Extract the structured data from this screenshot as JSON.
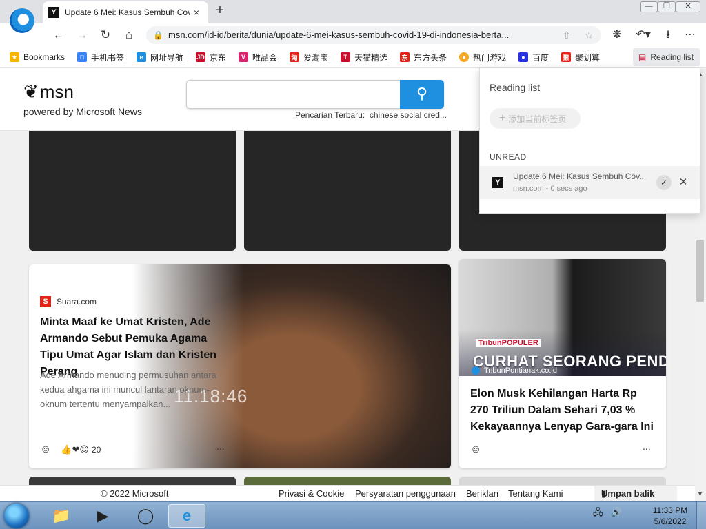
{
  "browser": {
    "tab_title": "Update 6 Mei: Kasus Sembuh Cov",
    "tab_close": "×",
    "new_tab": "+",
    "url": "msn.com/id-id/berita/dunia/update-6-mei-kasus-sembuh-covid-19-di-indonesia-berta...",
    "window_buttons": {
      "minimize": "—",
      "restore": "❐",
      "close": "✕"
    }
  },
  "bookmarks": {
    "items": [
      {
        "label": "Bookmarks",
        "color": "#f5b400"
      },
      {
        "label": "手机书签",
        "color": "#3b82f6"
      },
      {
        "label": "网址导航",
        "color": "#1f8fe0"
      },
      {
        "label": "京东",
        "color": "#c8102e"
      },
      {
        "label": "唯品会",
        "color": "#d6246e"
      },
      {
        "label": "爱淘宝",
        "color": "#e2231a"
      },
      {
        "label": "天猫精选",
        "color": "#c8102e"
      },
      {
        "label": "东方头条",
        "color": "#e2231a"
      },
      {
        "label": "热门游戏",
        "color": "#f5a623"
      },
      {
        "label": "百度",
        "color": "#2932e1"
      },
      {
        "label": "聚划算",
        "color": "#e2231a"
      }
    ],
    "reading_list_label": "Reading list"
  },
  "msn": {
    "logo_text": "msn",
    "powered_by": "powered by Microsoft News",
    "recent_label": "Pencarian Terbaru:",
    "recent_term": "chinese social cred..."
  },
  "cards": {
    "card1": {
      "source": "Suara.com",
      "source_color": "#e2231a",
      "headline": "Minta Maaf ke Umat Kristen, Ade Armando Sebut Pemuka Agama Tipu Umat Agar Islam dan Kristen Perang",
      "summary": "Ade Armando menuding permusuhan antara kedua ahgama ini muncul lantaran oknum-oknum tertentu menyampaikan...",
      "video_time": "11.18:46",
      "reactions_count": "20",
      "more": "..."
    },
    "card2": {
      "source": "TribunPontianak.co.id",
      "popular_tag": "TribunPOPULER",
      "banner": "CURHAT SEORANG PENDIRI TWITTER",
      "headline": "Elon Musk Kehilangan Harta Rp 270 Triliun Dalam Sehari 7,03 % Kekayaannya Lenyap Gara-gara Ini",
      "more": "..."
    }
  },
  "footer": {
    "copyright": "© 2022 Microsoft",
    "links": [
      "Privasi & Cookie",
      "Persyaratan penggunaan",
      "Beriklan",
      "Tentang Kami"
    ],
    "feedback": "Umpan balik"
  },
  "reading_list": {
    "title": "Reading list",
    "add_button": "添加当前标签页",
    "section": "UNREAD",
    "item_title": "Update 6 Mei: Kasus Sembuh Cov...",
    "item_meta": "msn.com - 0 secs ago"
  },
  "taskbar": {
    "time": "11:33 PM",
    "date": "5/6/2022"
  }
}
